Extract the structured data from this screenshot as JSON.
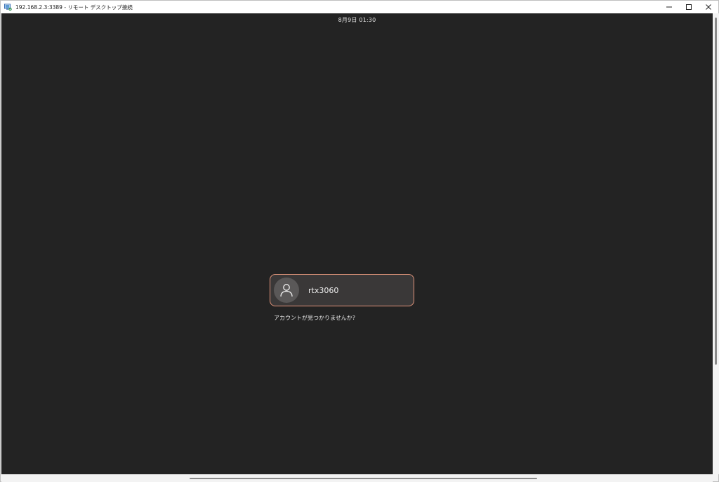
{
  "window": {
    "title": "192.168.2.3:3389 - リモート デスクトップ接続",
    "app_icon": "remote-desktop-icon",
    "controls": {
      "minimize_icon": "minimize-icon",
      "maximize_icon": "maximize-icon",
      "close_icon": "close-icon"
    }
  },
  "login_screen": {
    "clock": "8月9日  01:30",
    "user": {
      "name": "rtx3060",
      "avatar_icon": "user-avatar-icon"
    },
    "not_listed_link": "アカウントが見つかりませんか?"
  },
  "colors": {
    "background": "#232323",
    "card_background": "#3a3838",
    "card_focus_border": "#e0947a",
    "avatar_background": "#5a5858",
    "text": "#f0f0f0"
  }
}
